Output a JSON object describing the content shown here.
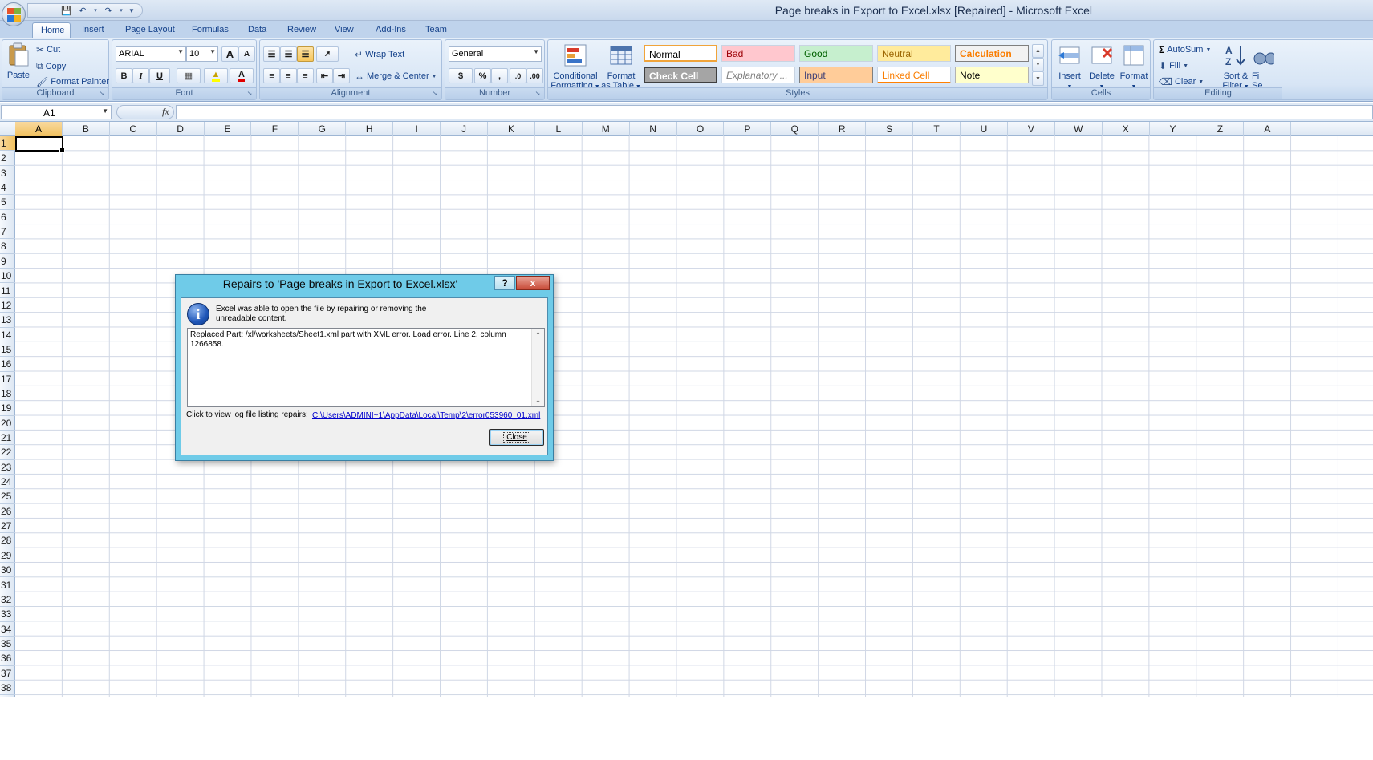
{
  "window": {
    "title": "Page breaks in Export to Excel.xlsx [Repaired]  -  Microsoft Excel"
  },
  "qat": {
    "save_icon": "save-icon",
    "undo_icon": "undo-icon",
    "redo_icon": "redo-icon"
  },
  "tabs": [
    "Home",
    "Insert",
    "Page Layout",
    "Formulas",
    "Data",
    "Review",
    "View",
    "Add-Ins",
    "Team"
  ],
  "ribbon": {
    "clipboard": {
      "label": "Clipboard",
      "paste": "Paste",
      "cut": "Cut",
      "copy": "Copy",
      "format_painter": "Format Painter"
    },
    "font": {
      "label": "Font",
      "font_name": "ARIAL",
      "font_size": "10",
      "bold": "B",
      "italic": "I",
      "underline": "U",
      "font_color_letter": "A",
      "grow": "A",
      "shrink": "A"
    },
    "alignment": {
      "label": "Alignment",
      "wrap_text": "Wrap Text",
      "merge_center": "Merge & Center"
    },
    "number": {
      "label": "Number",
      "format": "General",
      "currency": "$",
      "percent": "%",
      "comma": ",",
      "inc_dec": ".0",
      "dec_dec": ".00"
    },
    "styles": {
      "label": "Styles",
      "conditional_formatting": [
        "Conditional",
        "Formatting"
      ],
      "format_as_table": [
        "Format",
        "as Table"
      ],
      "cells": [
        {
          "name": "Normal"
        },
        {
          "name": "Bad"
        },
        {
          "name": "Good"
        },
        {
          "name": "Neutral"
        },
        {
          "name": "Calculation"
        },
        {
          "name": "Check Cell"
        },
        {
          "name": "Explanatory ..."
        },
        {
          "name": "Input"
        },
        {
          "name": "Linked Cell"
        },
        {
          "name": "Note"
        }
      ]
    },
    "cells": {
      "label": "Cells",
      "insert": "Insert",
      "delete": "Delete",
      "format": "Format"
    },
    "editing": {
      "label": "Editing",
      "autosum": "AutoSum",
      "fill": "Fill",
      "clear": "Clear",
      "sort_filter": [
        "Sort &",
        "Filter"
      ],
      "find_select": [
        "Fi",
        "Se"
      ]
    }
  },
  "formula_bar": {
    "name_box": "A1",
    "fx": "fx",
    "value": ""
  },
  "grid": {
    "columns": [
      "A",
      "B",
      "C",
      "D",
      "E",
      "F",
      "G",
      "H",
      "I",
      "J",
      "K",
      "L",
      "M",
      "N",
      "O",
      "P",
      "Q",
      "R",
      "S",
      "T",
      "U",
      "V",
      "W",
      "X",
      "Y",
      "Z",
      "A"
    ],
    "rows": [
      "1",
      "2",
      "3",
      "4",
      "5",
      "6",
      "7",
      "8",
      "9",
      "10",
      "11",
      "12",
      "13",
      "14",
      "15",
      "16",
      "17",
      "18",
      "19",
      "20",
      "21",
      "22",
      "23",
      "24",
      "25",
      "26",
      "27",
      "28",
      "29",
      "30",
      "31",
      "32",
      "33",
      "34",
      "35",
      "36",
      "37",
      "38"
    ]
  },
  "dialog": {
    "title": "Repairs to 'Page breaks in Export to Excel.xlsx'",
    "help": "?",
    "close_x": "x",
    "message_line1": "Excel was able to open the file by repairing or removing the",
    "message_line2": "unreadable content.",
    "details_line1": "Replaced Part: /xl/worksheets/Sheet1.xml part with XML error.  Load error. Line 2, column",
    "details_line2": "1266858.",
    "log_label": "Click to view log file listing repairs:",
    "log_link": "C:\\Users\\ADMINI~1\\AppData\\Local\\Temp\\2\\error053960_01.xml",
    "close_button": "Close"
  }
}
